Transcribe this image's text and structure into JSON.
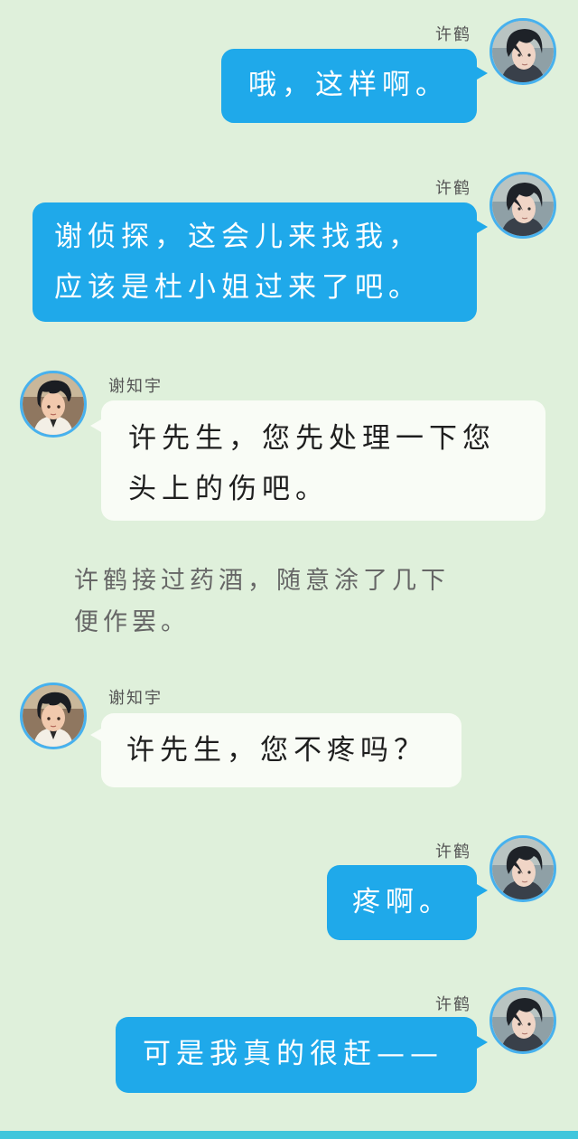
{
  "colors": {
    "background": "#dff0db",
    "self_bubble": "#1fa9ea",
    "other_bubble": "#f9fcf6",
    "avatar_ring": "#47b1ee",
    "bottom_bar": "#3fc6dc"
  },
  "messages": [
    {
      "sender": "许鹤",
      "side": "right",
      "lines": [
        "哦，这样啊。"
      ]
    },
    {
      "sender": "许鹤",
      "side": "right",
      "lines": [
        "谢侦探，这会儿来找我，",
        "应该是杜小姐过来了吧。"
      ]
    },
    {
      "sender": "谢知宇",
      "side": "left",
      "lines": [
        "许先生，您先处理一下您",
        "头上的伤吧。"
      ]
    },
    {
      "sender": "谢知宇",
      "side": "left",
      "lines": [
        "许先生，您不疼吗？"
      ]
    },
    {
      "sender": "许鹤",
      "side": "right",
      "lines": [
        "疼啊。"
      ]
    },
    {
      "sender": "许鹤",
      "side": "right",
      "lines": [
        "可是我真的很赶——"
      ]
    }
  ],
  "narration": {
    "lines": [
      "许鹤接过药酒，随意涂了几下",
      "便作罢。"
    ]
  },
  "avatars": {
    "self": "avatar-xu-he-icon",
    "other": "avatar-xie-zhiyu-icon"
  }
}
